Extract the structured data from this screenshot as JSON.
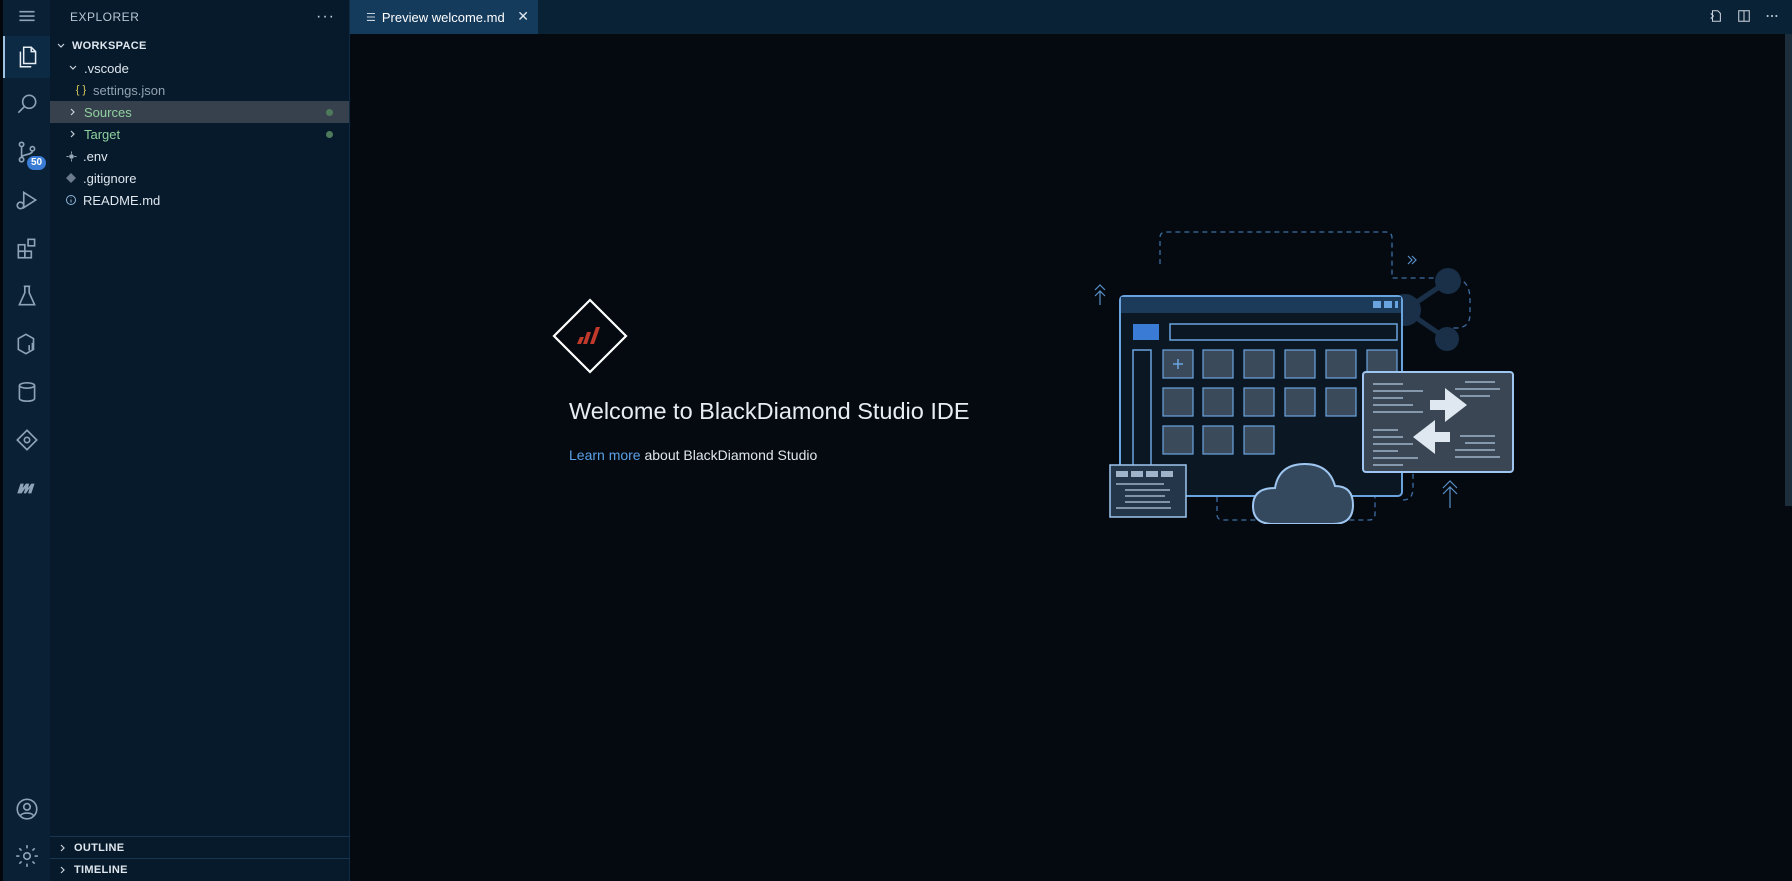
{
  "activity_bar": {
    "source_control_badge": "50"
  },
  "sidebar": {
    "title": "EXPLORER",
    "more": "···",
    "workspace_label": "WORKSPACE",
    "items": [
      {
        "label": ".vscode"
      },
      {
        "label": "settings.json",
        "icon": "{ }"
      },
      {
        "label": "Sources"
      },
      {
        "label": "Target"
      },
      {
        "label": ".env"
      },
      {
        "label": ".gitignore"
      },
      {
        "label": "README.md"
      }
    ],
    "outline_label": "OUTLINE",
    "timeline_label": "TIMELINE"
  },
  "tabs": [
    {
      "label": "Preview welcome.md"
    }
  ],
  "welcome": {
    "title": "Welcome to BlackDiamond Studio IDE",
    "learn_link": "Learn more",
    "learn_rest": " about BlackDiamond Studio"
  },
  "colors": {
    "accent": "#5aa0e8",
    "logo_red": "#c0392b",
    "git_green": "#8fd19e"
  }
}
